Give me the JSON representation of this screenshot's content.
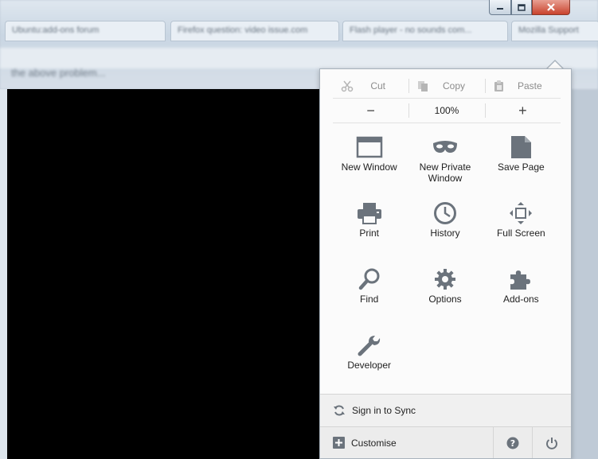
{
  "background": {
    "tabs": [
      "Ubuntu:add-ons forum",
      "Firefox question: video issue.com",
      "Flash player - no sounds com...",
      "Mozilla Support"
    ],
    "subtext": "the above problem..."
  },
  "menu": {
    "edit": [
      {
        "label": "Cut",
        "icon": "scissors-icon"
      },
      {
        "label": "Copy",
        "icon": "copy-icon"
      },
      {
        "label": "Paste",
        "icon": "paste-icon"
      }
    ],
    "zoom": {
      "out": "−",
      "level": "100%",
      "in": "+"
    },
    "tiles": [
      {
        "label": "New Window",
        "icon": "window-icon"
      },
      {
        "label": "New Private Window",
        "icon": "mask-icon"
      },
      {
        "label": "Save Page",
        "icon": "page-icon"
      },
      {
        "label": "Print",
        "icon": "printer-icon"
      },
      {
        "label": "History",
        "icon": "clock-icon"
      },
      {
        "label": "Full Screen",
        "icon": "fullscreen-icon"
      },
      {
        "label": "Find",
        "icon": "magnifier-icon"
      },
      {
        "label": "Options",
        "icon": "gear-icon"
      },
      {
        "label": "Add-ons",
        "icon": "puzzle-icon"
      },
      {
        "label": "Developer",
        "icon": "wrench-icon"
      }
    ],
    "sync_label": "Sign in to Sync",
    "customise_label": "Customise"
  },
  "colors": {
    "icon": "#6b737c",
    "disabled": "#b5b5b5",
    "close": "#c9432d"
  }
}
